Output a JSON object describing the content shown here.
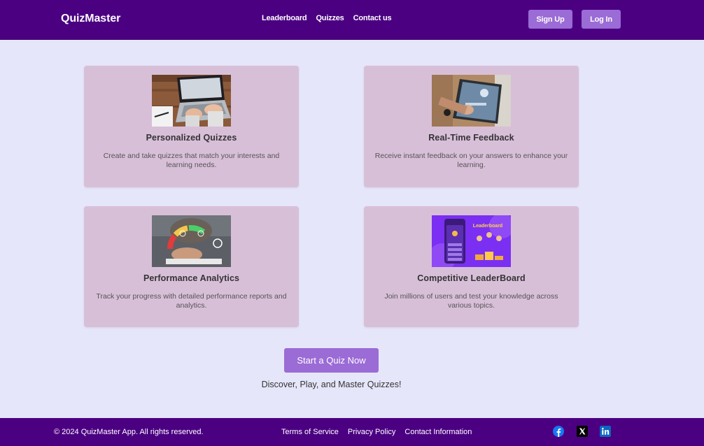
{
  "header": {
    "brand": "QuizMaster",
    "nav": [
      "Leaderboard",
      "Quizzes",
      "Contact us"
    ],
    "signup_label": "Sign Up",
    "login_label": "Log In"
  },
  "features": [
    {
      "title": "Personalized Quizzes",
      "description": "Create and take quizzes that match your interests and learning needs.",
      "image_icon": "laptop-typing-photo"
    },
    {
      "title": "Real-Time Feedback",
      "description": "Receive instant feedback on your answers to enhance your learning.",
      "image_icon": "tablet-feedback-photo"
    },
    {
      "title": "Performance Analytics",
      "description": "Track your progress with detailed performance reports and analytics.",
      "image_icon": "analytics-hand-photo"
    },
    {
      "title": "Competitive LeaderBoard",
      "description": "Join millions of users and test your knowledge across various topics.",
      "image_icon": "leaderboard-illustration",
      "image_text": "Leaderboard"
    }
  ],
  "cta": {
    "button_label": "Start a Quiz Now",
    "tagline": "Discover, Play, and Master Quizzes!"
  },
  "footer": {
    "copyright": "© 2024 QuizMaster App. All rights reserved.",
    "links": [
      "Terms of Service",
      "Privacy Policy",
      "Contact Information"
    ],
    "social_icons": [
      "facebook-icon",
      "x-twitter-icon",
      "linkedin-icon"
    ]
  },
  "colors": {
    "header_bg": "#4b0082",
    "page_bg": "#e6e6fa",
    "card_bg": "#d8bfd8",
    "button_bg": "#9b6bd6"
  }
}
